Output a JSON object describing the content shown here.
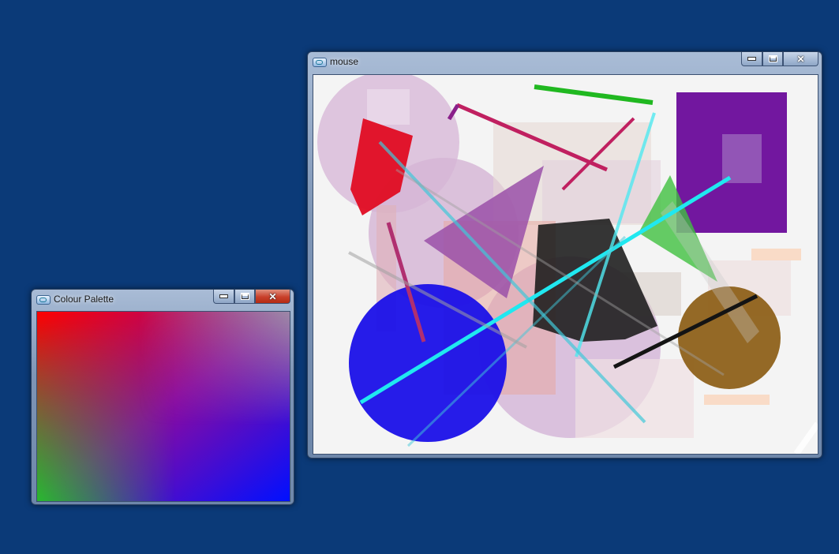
{
  "windows": {
    "palette": {
      "title": "Colour Palette",
      "buttons": {
        "minimize": "minimize",
        "maximize": "maximize",
        "close": "close"
      }
    },
    "mouse": {
      "title": "mouse",
      "buttons": {
        "minimize": "minimize",
        "maximize": "maximize",
        "close": "close"
      }
    }
  },
  "icons": {
    "app": "app-icon",
    "minimize": "minimize-icon",
    "maximize": "maximize-icon",
    "close": "close-icon"
  },
  "colors": {
    "desktop": "#0b3a78",
    "canvas_bg": "#f4f4f4"
  }
}
